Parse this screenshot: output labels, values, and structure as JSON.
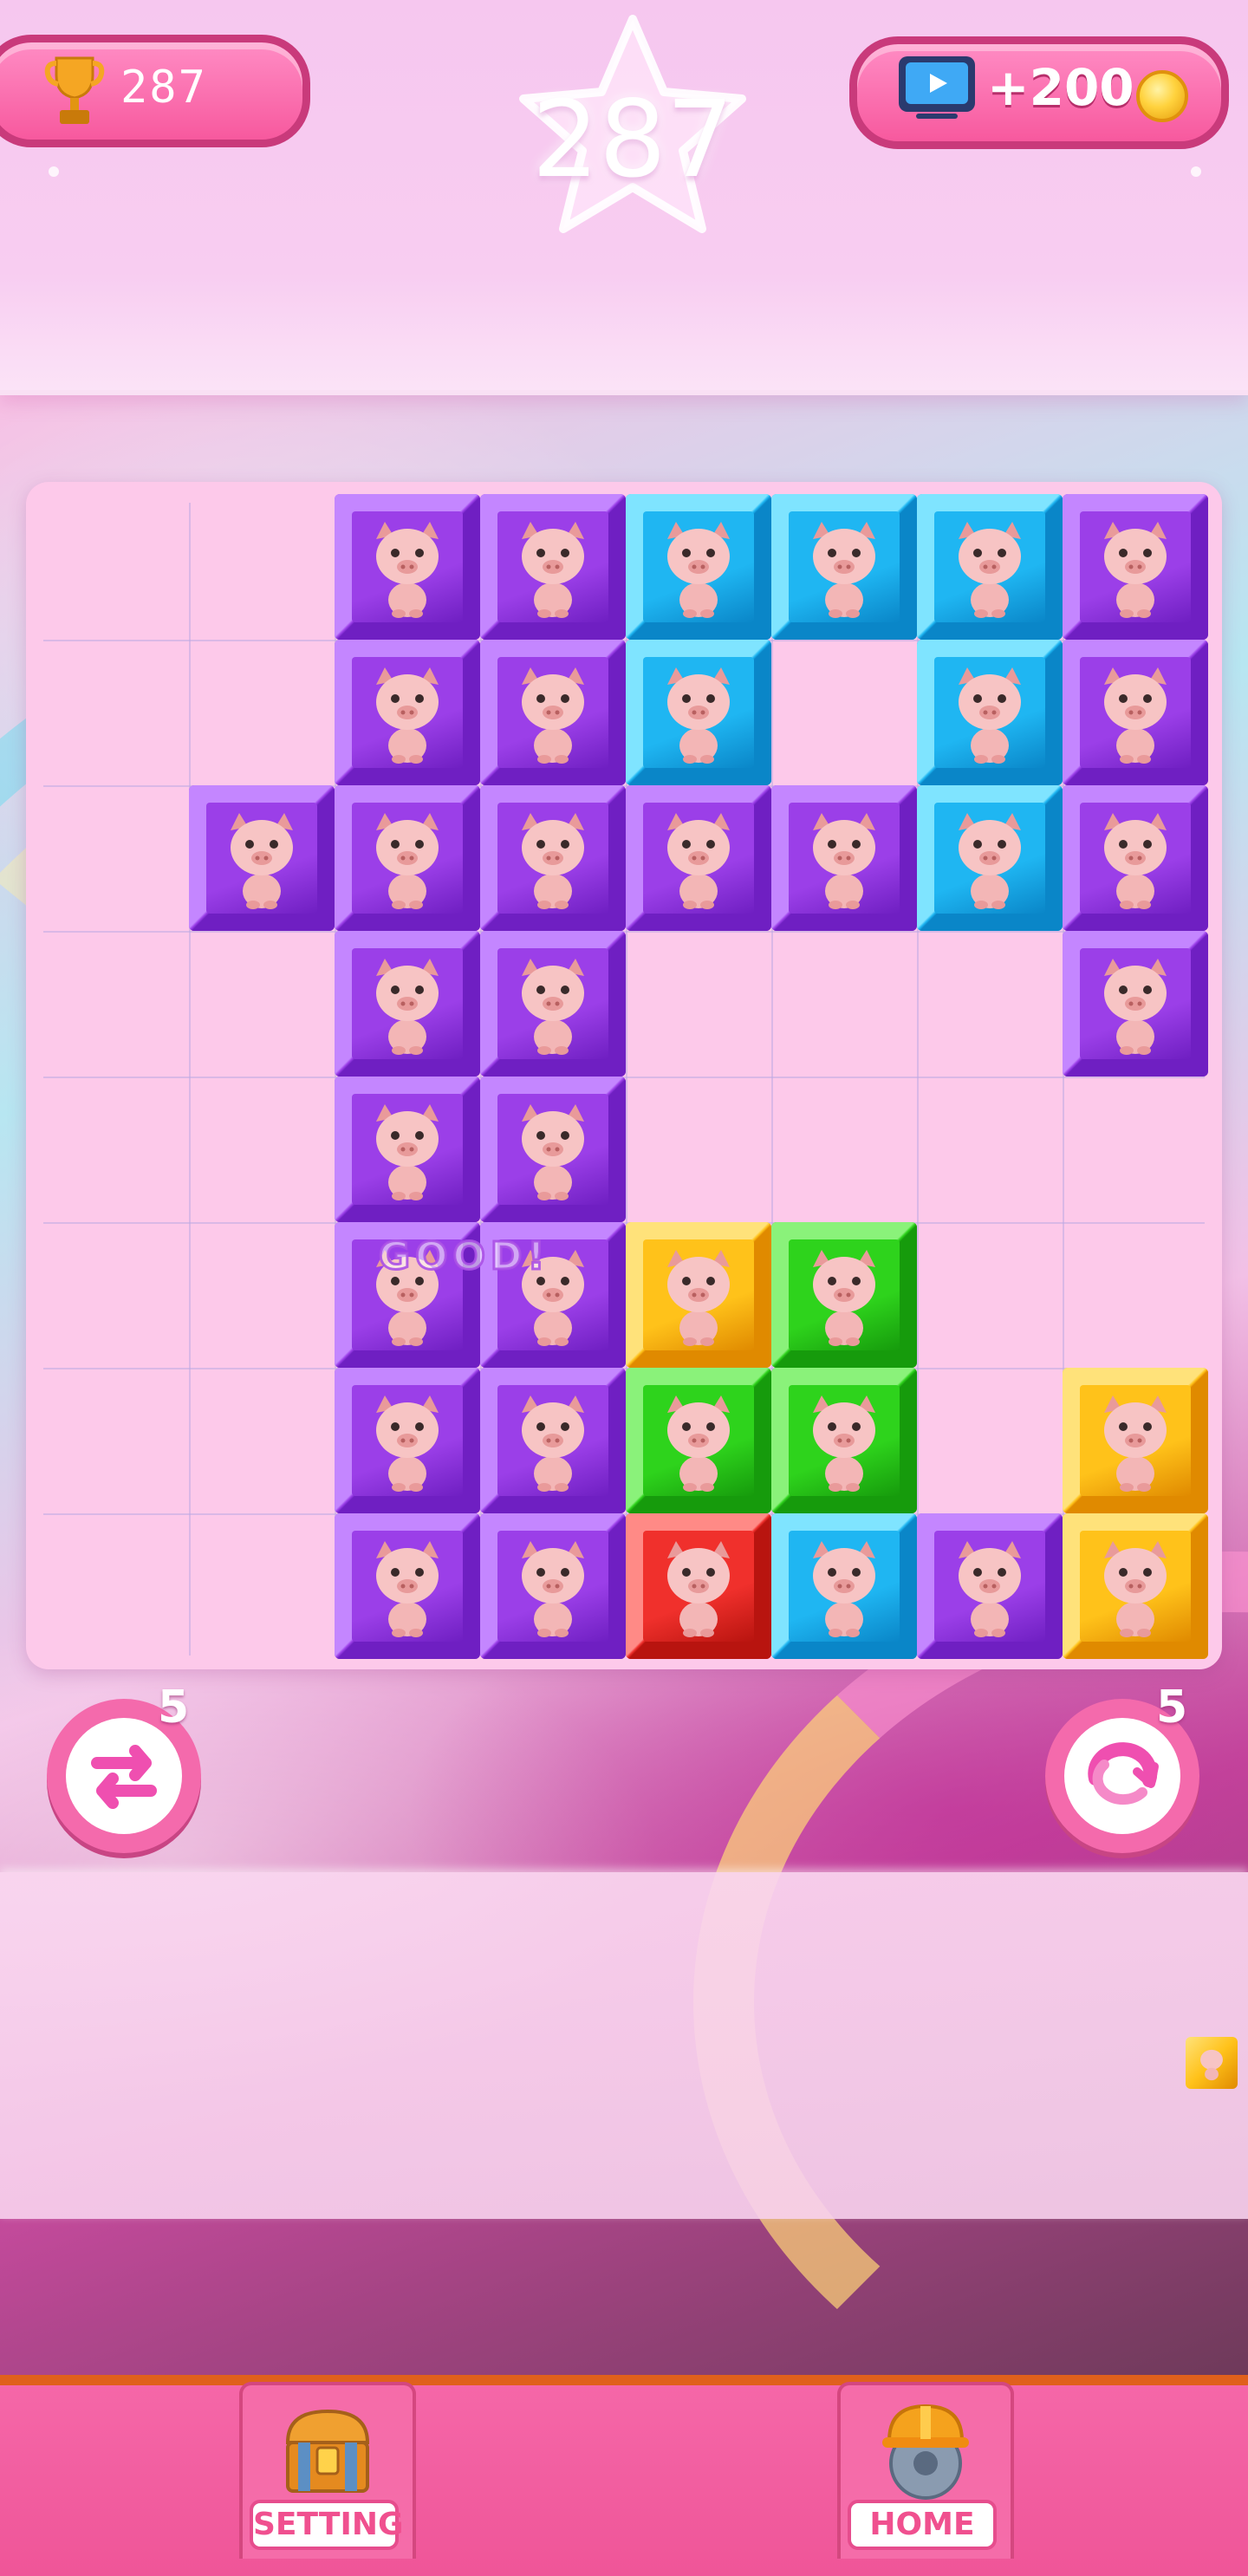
{
  "header": {
    "best_score": "287",
    "current_score": "287",
    "reward_label": "+200"
  },
  "board": {
    "columns": 8,
    "rows": 8,
    "combo_text": "GOOD!",
    "tiles": [
      {
        "row": 0,
        "col": 2,
        "color": "purple"
      },
      {
        "row": 0,
        "col": 3,
        "color": "purple"
      },
      {
        "row": 0,
        "col": 4,
        "color": "blue"
      },
      {
        "row": 0,
        "col": 5,
        "color": "blue"
      },
      {
        "row": 0,
        "col": 6,
        "color": "blue"
      },
      {
        "row": 0,
        "col": 7,
        "color": "purple"
      },
      {
        "row": 1,
        "col": 2,
        "color": "purple"
      },
      {
        "row": 1,
        "col": 3,
        "color": "purple"
      },
      {
        "row": 1,
        "col": 4,
        "color": "blue"
      },
      {
        "row": 1,
        "col": 6,
        "color": "blue"
      },
      {
        "row": 1,
        "col": 7,
        "color": "purple"
      },
      {
        "row": 2,
        "col": 1,
        "color": "purple"
      },
      {
        "row": 2,
        "col": 2,
        "color": "purple"
      },
      {
        "row": 2,
        "col": 3,
        "color": "purple"
      },
      {
        "row": 2,
        "col": 4,
        "color": "purple"
      },
      {
        "row": 2,
        "col": 5,
        "color": "purple"
      },
      {
        "row": 2,
        "col": 6,
        "color": "blue"
      },
      {
        "row": 2,
        "col": 7,
        "color": "purple"
      },
      {
        "row": 3,
        "col": 2,
        "color": "purple"
      },
      {
        "row": 3,
        "col": 3,
        "color": "purple"
      },
      {
        "row": 3,
        "col": 7,
        "color": "purple"
      },
      {
        "row": 4,
        "col": 2,
        "color": "purple"
      },
      {
        "row": 4,
        "col": 3,
        "color": "purple"
      },
      {
        "row": 5,
        "col": 2,
        "color": "purple"
      },
      {
        "row": 5,
        "col": 3,
        "color": "purple"
      },
      {
        "row": 5,
        "col": 4,
        "color": "yellow"
      },
      {
        "row": 5,
        "col": 5,
        "color": "green"
      },
      {
        "row": 6,
        "col": 2,
        "color": "purple"
      },
      {
        "row": 6,
        "col": 3,
        "color": "purple"
      },
      {
        "row": 6,
        "col": 4,
        "color": "green"
      },
      {
        "row": 6,
        "col": 5,
        "color": "green"
      },
      {
        "row": 6,
        "col": 7,
        "color": "yellow"
      },
      {
        "row": 7,
        "col": 2,
        "color": "purple"
      },
      {
        "row": 7,
        "col": 3,
        "color": "purple"
      },
      {
        "row": 7,
        "col": 4,
        "color": "red"
      },
      {
        "row": 7,
        "col": 5,
        "color": "blue"
      },
      {
        "row": 7,
        "col": 6,
        "color": "purple"
      },
      {
        "row": 7,
        "col": 7,
        "color": "yellow"
      }
    ]
  },
  "tile_colors": {
    "purple": {
      "face": "#9b3fe8",
      "light": "#c486ff",
      "dark": "#6f1fc2"
    },
    "blue": {
      "face": "#1fb6f2",
      "light": "#7fe4ff",
      "dark": "#0a86c8"
    },
    "yellow": {
      "face": "#ffc21a",
      "light": "#ffe27a",
      "dark": "#e08a00"
    },
    "green": {
      "face": "#2ed31c",
      "light": "#8af27a",
      "dark": "#169b0c"
    },
    "red": {
      "face": "#f0302c",
      "light": "#ff8a86",
      "dark": "#b8140f"
    }
  },
  "powerups": {
    "swap": {
      "count": "5",
      "icon": "swap-arrows-icon"
    },
    "rotate": {
      "count": "5",
      "icon": "rotate-icon"
    }
  },
  "nav": {
    "setting_label": "SETTING",
    "setting_icon": "treasure-chest-icon",
    "home_label": "HOME",
    "home_icon": "hardhat-saw-icon"
  }
}
